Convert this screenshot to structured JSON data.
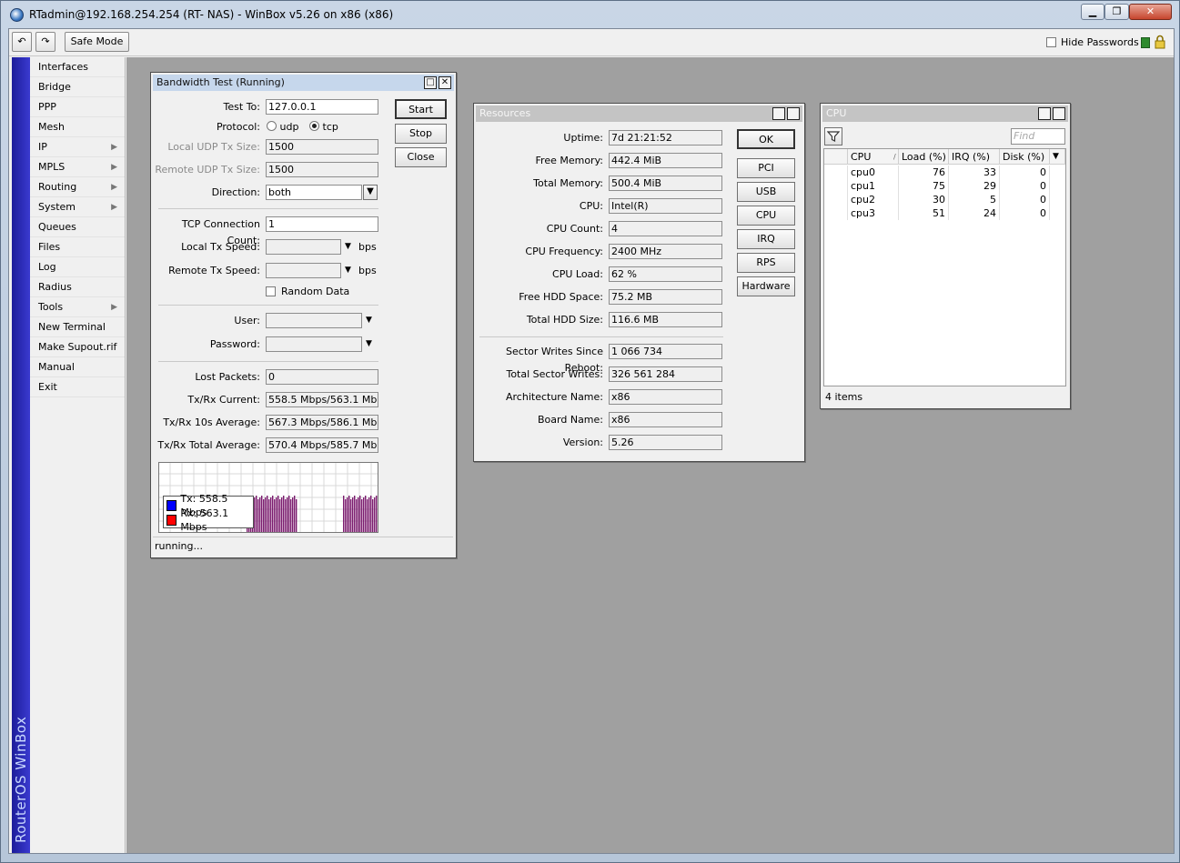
{
  "window": {
    "title": "RTadmin@192.168.254.254 (RT- NAS) - WinBox v5.26 on x86 (x86)",
    "minimize": "▁",
    "maximize": "❐",
    "close": "✕"
  },
  "toolbar": {
    "undo_icon": "↶",
    "redo_icon": "↷",
    "safe_mode": "Safe Mode",
    "hide_passwords": "Hide Passwords"
  },
  "brand": "RouterOS WinBox",
  "menu": [
    {
      "label": "Interfaces",
      "arrow": ""
    },
    {
      "label": "Bridge",
      "arrow": ""
    },
    {
      "label": "PPP",
      "arrow": ""
    },
    {
      "label": "Mesh",
      "arrow": ""
    },
    {
      "label": "IP",
      "arrow": "▶"
    },
    {
      "label": "MPLS",
      "arrow": "▶"
    },
    {
      "label": "Routing",
      "arrow": "▶"
    },
    {
      "label": "System",
      "arrow": "▶"
    },
    {
      "label": "Queues",
      "arrow": ""
    },
    {
      "label": "Files",
      "arrow": ""
    },
    {
      "label": "Log",
      "arrow": ""
    },
    {
      "label": "Radius",
      "arrow": ""
    },
    {
      "label": "Tools",
      "arrow": "▶"
    },
    {
      "label": "New Terminal",
      "arrow": ""
    },
    {
      "label": "Make Supout.rif",
      "arrow": ""
    },
    {
      "label": "Manual",
      "arrow": ""
    },
    {
      "label": "Exit",
      "arrow": ""
    }
  ],
  "bwtest": {
    "title": "Bandwidth Test (Running)",
    "test_to_label": "Test To:",
    "test_to": "127.0.0.1",
    "protocol_label": "Protocol:",
    "udp": "udp",
    "tcp": "tcp",
    "local_udp_label": "Local UDP Tx Size:",
    "local_udp": "1500",
    "remote_udp_label": "Remote UDP Tx Size:",
    "remote_udp": "1500",
    "direction_label": "Direction:",
    "direction": "both",
    "tcp_conn_label": "TCP Connection Count:",
    "tcp_conn": "1",
    "local_tx_label": "Local Tx Speed:",
    "remote_tx_label": "Remote Tx Speed:",
    "bps": "bps",
    "random_data": "Random Data",
    "user_label": "User:",
    "password_label": "Password:",
    "lost_label": "Lost Packets:",
    "lost": "0",
    "current_label": "Tx/Rx Current:",
    "current": "558.5 Mbps/563.1 Mbps",
    "avg10_label": "Tx/Rx 10s Average:",
    "avg10": "567.3 Mbps/586.1 Mbps",
    "total_label": "Tx/Rx Total Average:",
    "total": "570.4 Mbps/585.7 Mbps",
    "start": "Start",
    "stop": "Stop",
    "close": "Close",
    "legend_tx": "Tx:  558.5 Mbps",
    "legend_rx": "Rx:  563.1 Mbps",
    "status": "running..."
  },
  "resources": {
    "title": "Resources",
    "fields": [
      {
        "label": "Uptime:",
        "value": "7d 21:21:52"
      },
      {
        "label": "Free Memory:",
        "value": "442.4 MiB"
      },
      {
        "label": "Total Memory:",
        "value": "500.4 MiB"
      },
      {
        "label": "CPU:",
        "value": "Intel(R)"
      },
      {
        "label": "CPU Count:",
        "value": "4"
      },
      {
        "label": "CPU Frequency:",
        "value": "2400 MHz"
      },
      {
        "label": "CPU Load:",
        "value": "62 %"
      },
      {
        "label": "Free HDD Space:",
        "value": "75.2 MB"
      },
      {
        "label": "Total HDD Size:",
        "value": "116.6 MB"
      }
    ],
    "fields2": [
      {
        "label": "Sector Writes Since Reboot:",
        "value": "1 066 734"
      },
      {
        "label": "Total Sector Writes:",
        "value": "326 561 284"
      },
      {
        "label": "Architecture Name:",
        "value": "x86"
      },
      {
        "label": "Board Name:",
        "value": "x86"
      },
      {
        "label": "Version:",
        "value": "5.26"
      }
    ],
    "buttons": [
      "OK",
      "PCI",
      "USB",
      "CPU",
      "IRQ",
      "RPS",
      "Hardware"
    ]
  },
  "cpu": {
    "title": "CPU",
    "find_placeholder": "Find",
    "columns": [
      "CPU",
      "Load (%)",
      "IRQ (%)",
      "Disk (%)"
    ],
    "rows": [
      {
        "cpu": "cpu0",
        "load": "76",
        "irq": "33",
        "disk": "0"
      },
      {
        "cpu": "cpu1",
        "load": "75",
        "irq": "29",
        "disk": "0"
      },
      {
        "cpu": "cpu2",
        "load": "30",
        "irq": "5",
        "disk": "0"
      },
      {
        "cpu": "cpu3",
        "load": "51",
        "irq": "24",
        "disk": "0"
      }
    ],
    "count": "4 items"
  },
  "colors": {
    "tx": "#0000ff",
    "rx": "#ff0000",
    "graph_bars": "#7a1a6e"
  }
}
